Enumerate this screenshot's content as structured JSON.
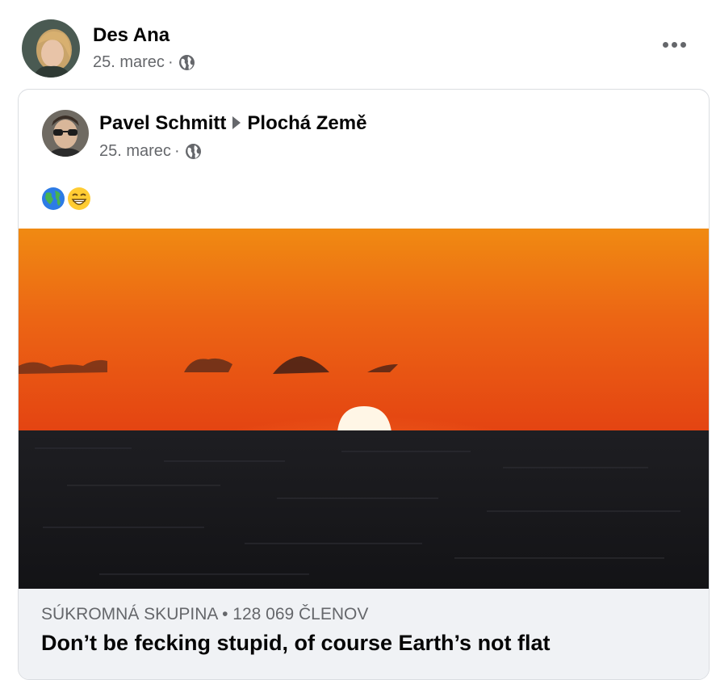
{
  "post": {
    "author": "Des Ana",
    "date": "25. marec",
    "separator": "·",
    "privacy_icon": "globe-icon",
    "menu_icon": "more-options-icon"
  },
  "shared_post": {
    "author": "Pavel Schmitt",
    "group": "Plochá Země",
    "date": "25. marec",
    "separator": "·",
    "privacy_icon": "globe-icon",
    "emojis": [
      "earth-globe-emoji",
      "grinning-face-emoji"
    ],
    "footer": {
      "group_privacy": "SÚKROMNÁ SKUPINA",
      "bullet": "•",
      "members": "128 069 ČLENOV",
      "title": "Don’t be fecking stupid, of course Earth’s not flat"
    }
  },
  "colors": {
    "secondary_text": "#65676b",
    "primary_text": "#050505",
    "footer_bg": "#f0f2f5",
    "sky_top": "#f07a10",
    "sky_bottom": "#e84a12",
    "sea": "#1a1a1d"
  }
}
